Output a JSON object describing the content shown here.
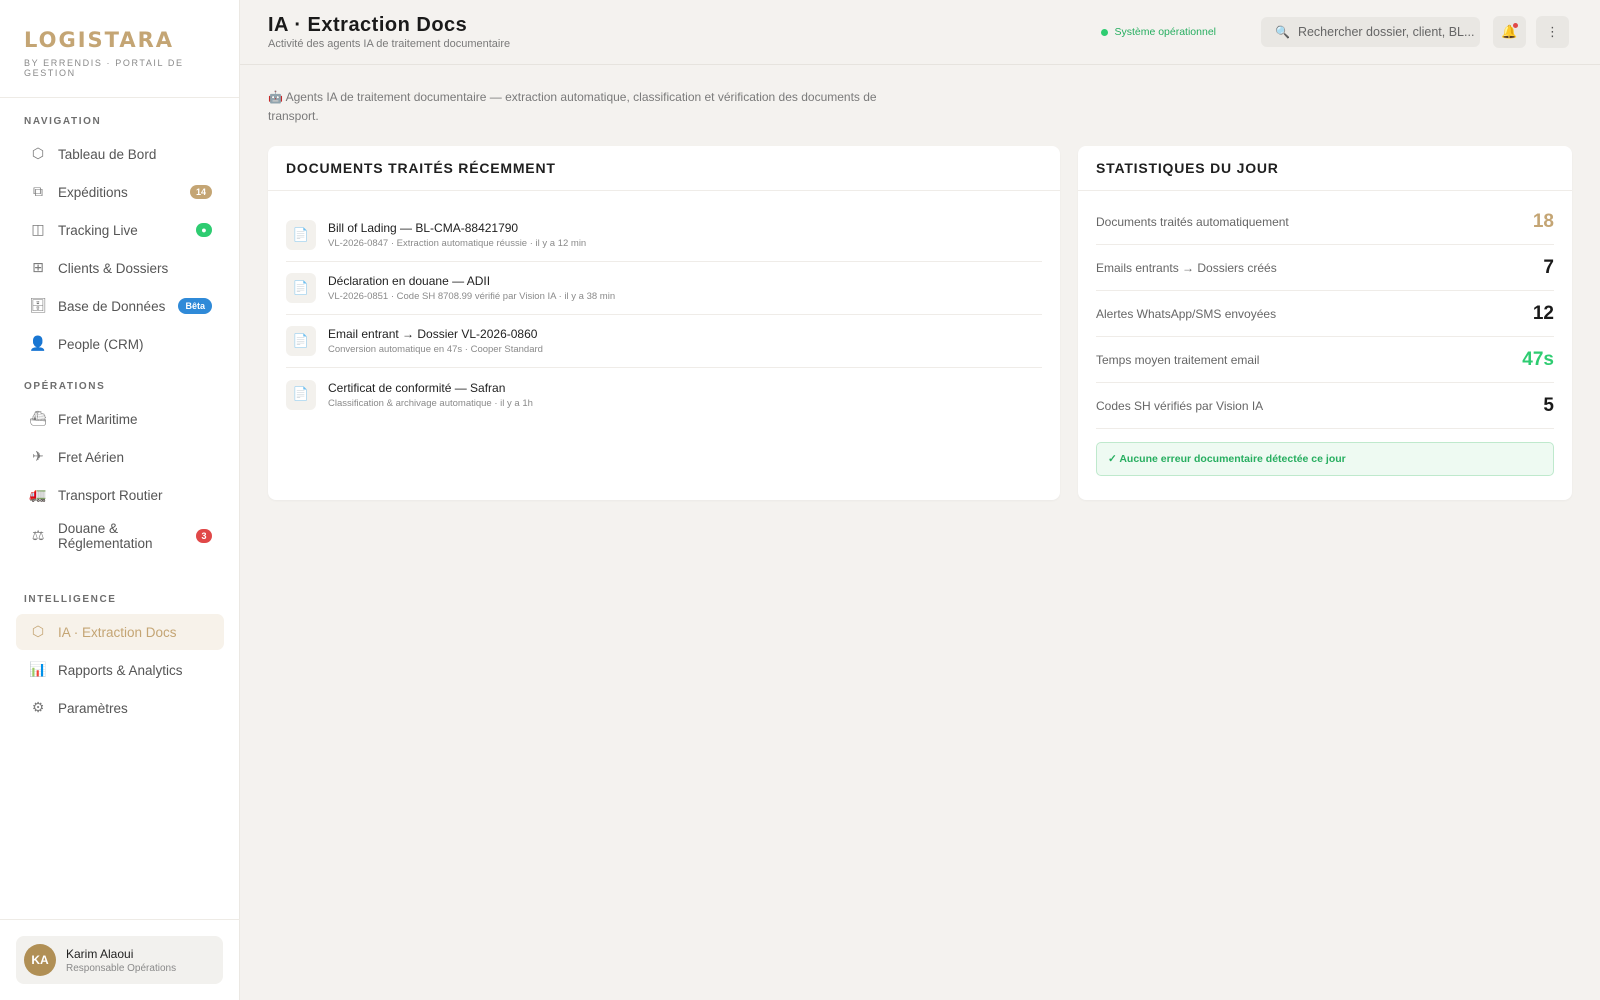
{
  "brand": {
    "name": "LOGISTARA",
    "subtitle": "BY ERRENDIS · PORTAIL DE GESTION"
  },
  "sidebar": {
    "sections": [
      {
        "title": "NAVIGATION",
        "items": [
          {
            "label": "Tableau de Bord",
            "icon": "hexagon-icon",
            "glyph": "⬡"
          },
          {
            "label": "Expéditions",
            "icon": "copy-icon",
            "glyph": "⧉",
            "badge": "14",
            "badge_color": "#c4a574"
          },
          {
            "label": "Tracking Live",
            "icon": "panel-icon",
            "glyph": "◫",
            "badge": "●",
            "badge_color": "#2ecc71"
          },
          {
            "label": "Clients & Dossiers",
            "icon": "grid-icon",
            "glyph": "⊞"
          },
          {
            "label": "Base de Données",
            "icon": "database-icon",
            "glyph": "🗄",
            "badge": "Bêta",
            "badge_color": "#2f8ad8"
          },
          {
            "label": "People (CRM)",
            "icon": "person-icon",
            "glyph": "👤"
          }
        ]
      },
      {
        "title": "OPÉRATIONS",
        "items": [
          {
            "label": "Fret Maritime",
            "icon": "ship-icon",
            "glyph": "⛴"
          },
          {
            "label": "Fret Aérien",
            "icon": "plane-icon",
            "glyph": "✈"
          },
          {
            "label": "Transport Routier",
            "icon": "truck-icon",
            "glyph": "🚛"
          },
          {
            "label": "Douane & Réglementation",
            "icon": "scale-icon",
            "glyph": "⚖",
            "badge": "3",
            "badge_color": "#e04848"
          }
        ]
      },
      {
        "title": "INTELLIGENCE",
        "items": [
          {
            "label": "IA · Extraction Docs",
            "icon": "hexagon-icon",
            "glyph": "⬡",
            "active": true
          },
          {
            "label": "Rapports & Analytics",
            "icon": "bar-chart-icon",
            "glyph": "📊"
          },
          {
            "label": "Paramètres",
            "icon": "gear-icon",
            "glyph": "⚙"
          }
        ]
      }
    ]
  },
  "user": {
    "initials": "KA",
    "name": "Karim Alaoui",
    "role": "Responsable Opérations"
  },
  "header": {
    "title": "IA · Extraction Docs",
    "subtitle": "Activité des agents IA de traitement documentaire",
    "status": "Système opérationnel",
    "search_placeholder": "Rechercher dossier, client, BL...",
    "notification_glyph": "🔔",
    "menu_glyph": "⋮"
  },
  "intro": {
    "glyph": "🤖",
    "text": "Agents IA de traitement documentaire — extraction automatique, classification et vérification des documents de transport."
  },
  "docs_card": {
    "title": "DOCUMENTS TRAITÉS RÉCEMMENT",
    "doc_glyph": "📄",
    "items": [
      {
        "title": "Bill of Lading — BL-CMA-88421790",
        "meta": "VL-2026-0847 · Extraction automatique réussie · il y a 12 min"
      },
      {
        "title": "Déclaration en douane — ADII",
        "meta": "VL-2026-0851 · Code SH 8708.99 vérifié par Vision IA · il y a 38 min"
      },
      {
        "title": "Email entrant → Dossier VL-2026-0860",
        "meta": "Conversion automatique en 47s · Cooper Standard"
      },
      {
        "title": "Certificat de conformité — Safran",
        "meta": "Classification & archivage automatique · il y a 1h"
      }
    ]
  },
  "stats_card": {
    "title": "STATISTIQUES DU JOUR",
    "items": [
      {
        "label": "Documents traités automatiquement",
        "value": "18",
        "color": "#c4a574"
      },
      {
        "label": "Emails entrants → Dossiers créés",
        "value": "7",
        "color": "#1a1a1a"
      },
      {
        "label": "Alertes WhatsApp/SMS envoyées",
        "value": "12",
        "color": "#1a1a1a"
      },
      {
        "label": "Temps moyen traitement email",
        "value": "47s",
        "color": "#2ecc71"
      },
      {
        "label": "Codes SH vérifiés par Vision IA",
        "value": "5",
        "color": "#1a1a1a"
      }
    ],
    "ok_message": "✓ Aucune erreur documentaire détectée ce jour"
  }
}
